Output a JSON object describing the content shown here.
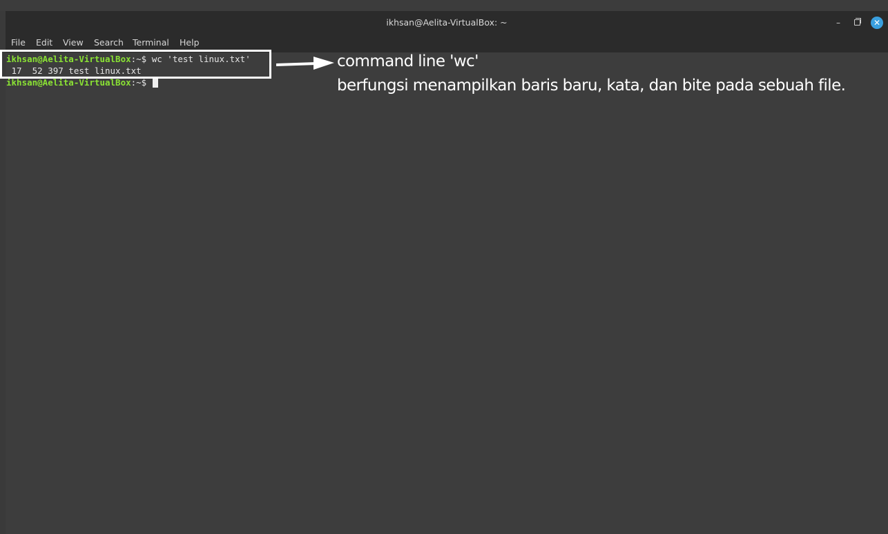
{
  "window": {
    "title": "ikhsan@Aelita-VirtualBox: ~",
    "minimize_glyph": "–",
    "close_glyph": "✕"
  },
  "menubar": {
    "items": [
      {
        "label": "File"
      },
      {
        "label": "Edit"
      },
      {
        "label": "View"
      },
      {
        "label": "Search"
      },
      {
        "label": "Terminal"
      },
      {
        "label": "Help"
      }
    ]
  },
  "terminal": {
    "prompt_user": "ikhsan@Aelita-VirtualBox",
    "prompt_suffix": ":~$ ",
    "command": "wc 'test linux.txt'",
    "output": " 17  52 397 test linux.txt",
    "prompt2_user": "ikhsan@Aelita-VirtualBox",
    "prompt2_suffix": ":~$ "
  },
  "annotation": {
    "line1": "command line 'wc'",
    "line2": "berfungsi menampilkan baris baru, kata, dan bite pada sebuah file."
  },
  "colors": {
    "prompt_user": "#8ae234",
    "terminal_bg": "#3d3d3d",
    "titlebar_bg": "#2b2b2b",
    "close_button": "#3aa0e0",
    "annotation": "#ffffff"
  },
  "icons": {
    "minimize": "minimize-icon",
    "maximize": "maximize-icon",
    "close": "close-icon",
    "arrow": "arrow-right-icon"
  }
}
